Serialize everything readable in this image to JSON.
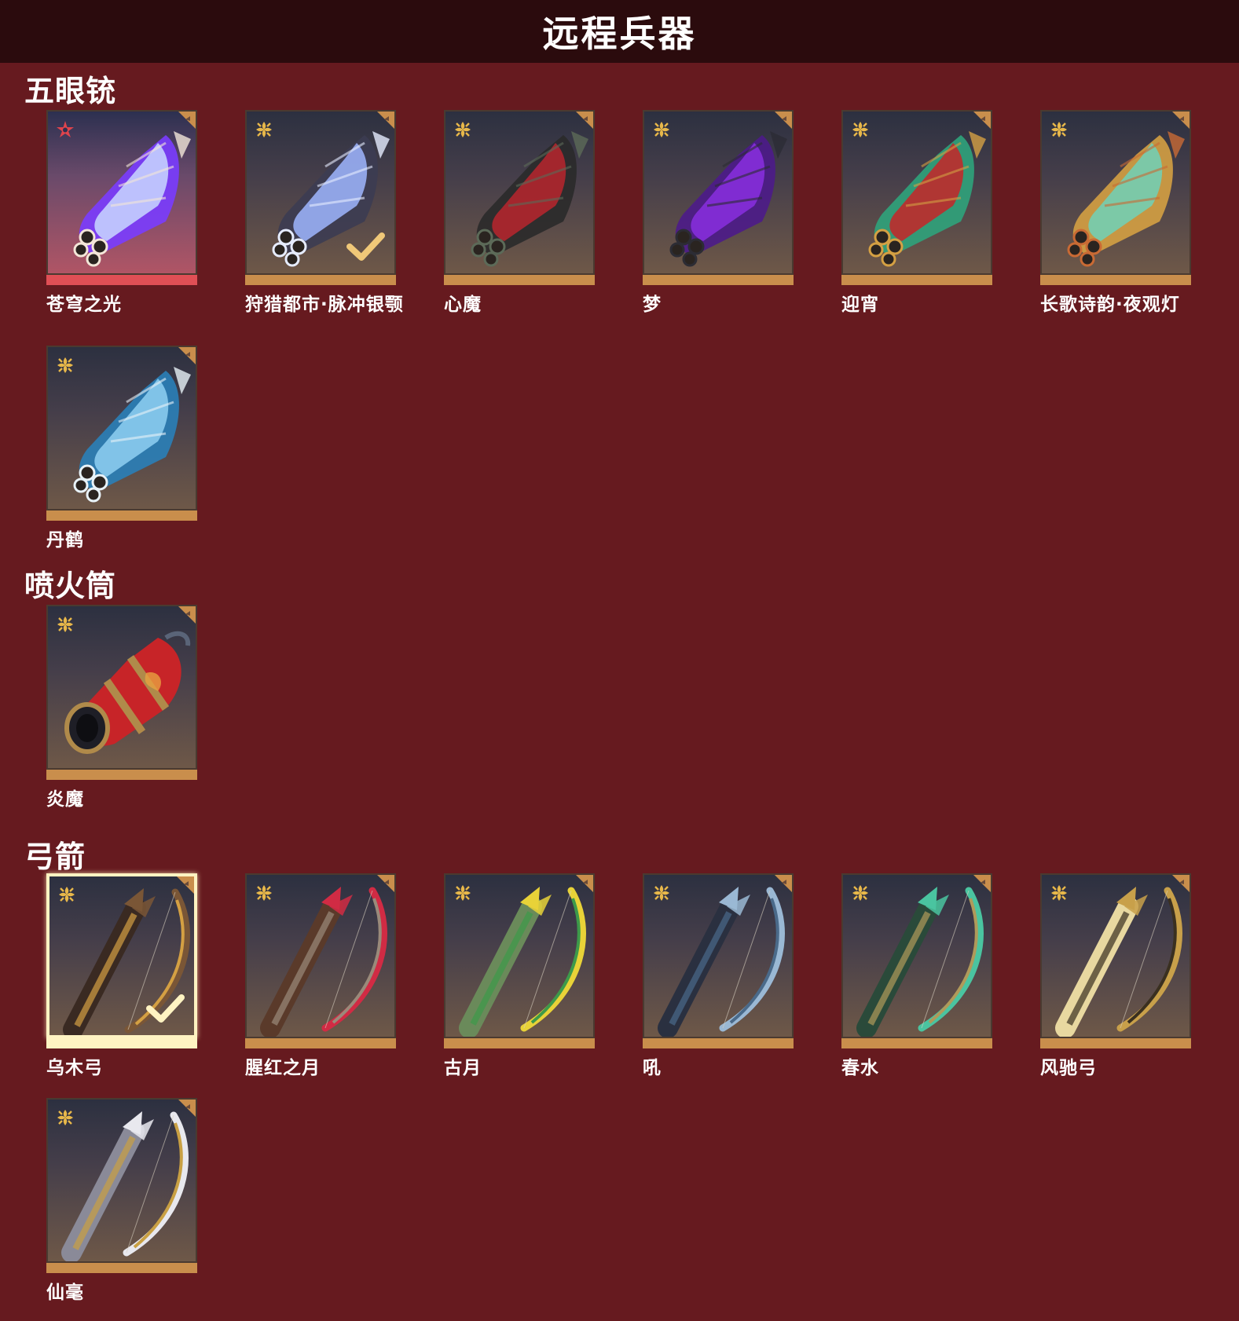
{
  "header": {
    "title": "远程兵器"
  },
  "icons": {
    "rarity_gold": "gold-flower-icon",
    "rarity_red": "red-star-flower-icon",
    "corner": "corner-tab-icon",
    "check": "check-mark-icon"
  },
  "colors": {
    "background": "#661a1f",
    "header_background": "#2b0b0d",
    "card_bar_gold": "#c98e4c",
    "card_bar_red": "#e04f55",
    "selected_border": "#fff3c2"
  },
  "sections": [
    {
      "title": "五眼铳",
      "items": [
        {
          "name": "苍穹之光",
          "rarity": "red",
          "selected": false,
          "equipped": false
        },
        {
          "name": "狩猎都市·脉冲银颚",
          "rarity": "gold",
          "selected": false,
          "equipped": true
        },
        {
          "name": "心魔",
          "rarity": "gold",
          "selected": false,
          "equipped": false
        },
        {
          "name": "梦",
          "rarity": "gold",
          "selected": false,
          "equipped": false
        },
        {
          "name": "迎宵",
          "rarity": "gold",
          "selected": false,
          "equipped": false
        },
        {
          "name": "长歌诗韵·夜观灯",
          "rarity": "gold",
          "selected": false,
          "equipped": false
        },
        {
          "name": "丹鹤",
          "rarity": "gold",
          "selected": false,
          "equipped": false
        }
      ]
    },
    {
      "title": "喷火筒",
      "items": [
        {
          "name": "炎魔",
          "rarity": "gold",
          "selected": false,
          "equipped": false
        }
      ]
    },
    {
      "title": "弓箭",
      "items": [
        {
          "name": "乌木弓",
          "rarity": "gold",
          "selected": true,
          "equipped": true
        },
        {
          "name": "腥红之月",
          "rarity": "gold",
          "selected": false,
          "equipped": false
        },
        {
          "name": "古月",
          "rarity": "gold",
          "selected": false,
          "equipped": false
        },
        {
          "name": "吼",
          "rarity": "gold",
          "selected": false,
          "equipped": false
        },
        {
          "name": "春水",
          "rarity": "gold",
          "selected": false,
          "equipped": false
        },
        {
          "name": "风驰弓",
          "rarity": "gold",
          "selected": false,
          "equipped": false
        },
        {
          "name": "仙毫",
          "rarity": "gold",
          "selected": false,
          "equipped": false
        }
      ]
    }
  ]
}
